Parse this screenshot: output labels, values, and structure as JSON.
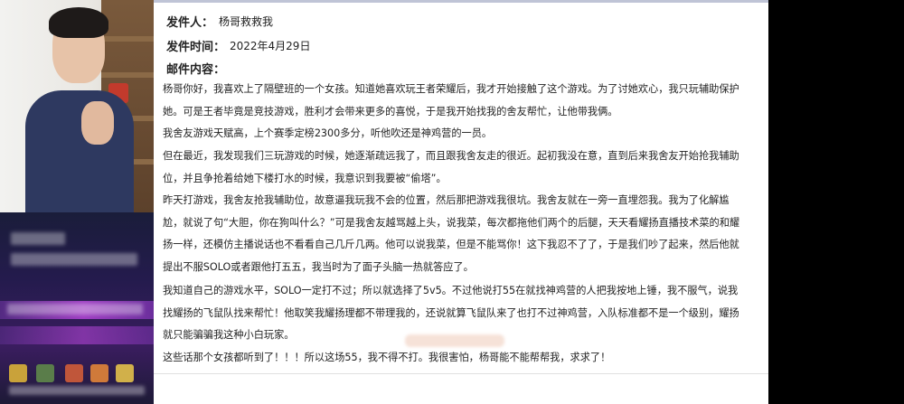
{
  "mail": {
    "sender_label": "发件人：",
    "sender_value": "杨哥救救我",
    "time_label": "发件时间：",
    "time_value": "2022年4月29日",
    "content_label": "邮件内容：",
    "paragraphs": [
      "杨哥你好，我喜欢上了隔壁班的一个女孩。知道她喜欢玩王者荣耀后，我才开始接触了这个游戏。为了讨她欢心，我只玩辅助保护她。可是王者毕竟是竞技游戏，胜利才会带来更多的喜悦，于是我开始找我的舍友帮忙，让他带我俩。",
      "我舍友游戏天赋高，上个赛季定榜2300多分，听他吹还是神鸡营的一员。",
      "但在最近，我发现我们三玩游戏的时候，她逐渐疏远我了，而且跟我舍友走的很近。起初我没在意，直到后来我舍友开始抢我辅助位，并且争抢着给她下楼打水的时候，我意识到我要被“偷塔”。",
      "昨天打游戏，我舍友抢我辅助位，故意逼我玩我不会的位置，然后那把游戏我很坑。我舍友就在一旁一直埋怨我。我为了化解尴尬，就说了句“大胆，你在狗叫什么？”可是我舍友越骂越上头，说我菜，每次都拖他们两个的后腿，天天看耀扬直播技术菜的和耀扬一样，还模仿主播说话也不看看自己几斤几两。他可以说我菜，但是不能骂你！这下我忍不了了，于是我们吵了起来，然后他就提出不服SOLO或者跟他打五五，我当时为了面子头脑一热就答应了。",
      "我知道自己的游戏水平，SOLO一定打不过；所以就选择了5v5。不过他说打55在就找神鸡营的人把我按地上锤，我不服气，说我找耀扬的飞鼠队找来帮忙！他取笑我耀扬理都不带理我的，还说就算飞鼠队来了也打不过神鸡营，入队标准都不是一个级别，耀扬就只能骗骗我这种小白玩家。",
      "这些话那个女孩都听到了！！！所以这场55，我不得不打。我很害怕，杨哥能不能帮帮我，求求了！"
    ]
  }
}
